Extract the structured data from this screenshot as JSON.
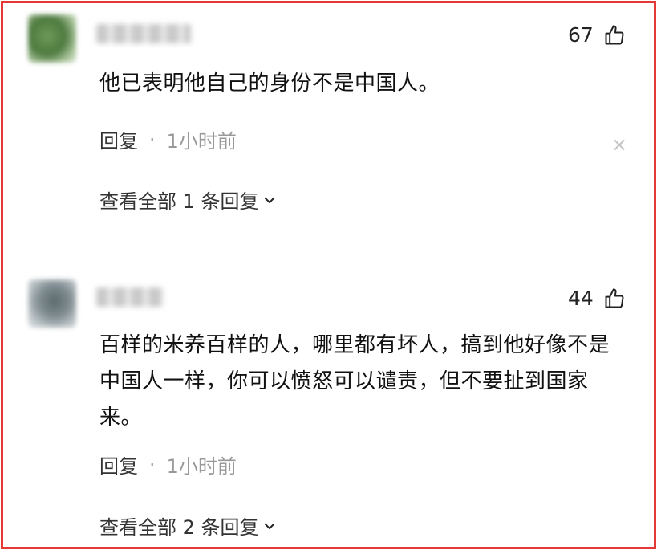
{
  "comments": [
    {
      "likes": "67",
      "text": "他已表明他自己的身份不是中国人。",
      "reply_label": "回复",
      "separator": "·",
      "time": "1小时前",
      "view_replies": "查看全部 1 条回复"
    },
    {
      "likes": "44",
      "text": "百样的米养百样的人，哪里都有坏人，搞到他好像不是中国人一样，你可以愤怒可以谴责，但不要扯到国家来。",
      "reply_label": "回复",
      "separator": "·",
      "time": "1小时前",
      "view_replies": "查看全部 2 条回复"
    }
  ],
  "close_glyph": "×",
  "icons": [
    "thumbs-up-icon",
    "chevron-down-icon",
    "close-icon"
  ],
  "colors": {
    "border": "#e53935",
    "muted": "#999999",
    "text": "#111111"
  }
}
